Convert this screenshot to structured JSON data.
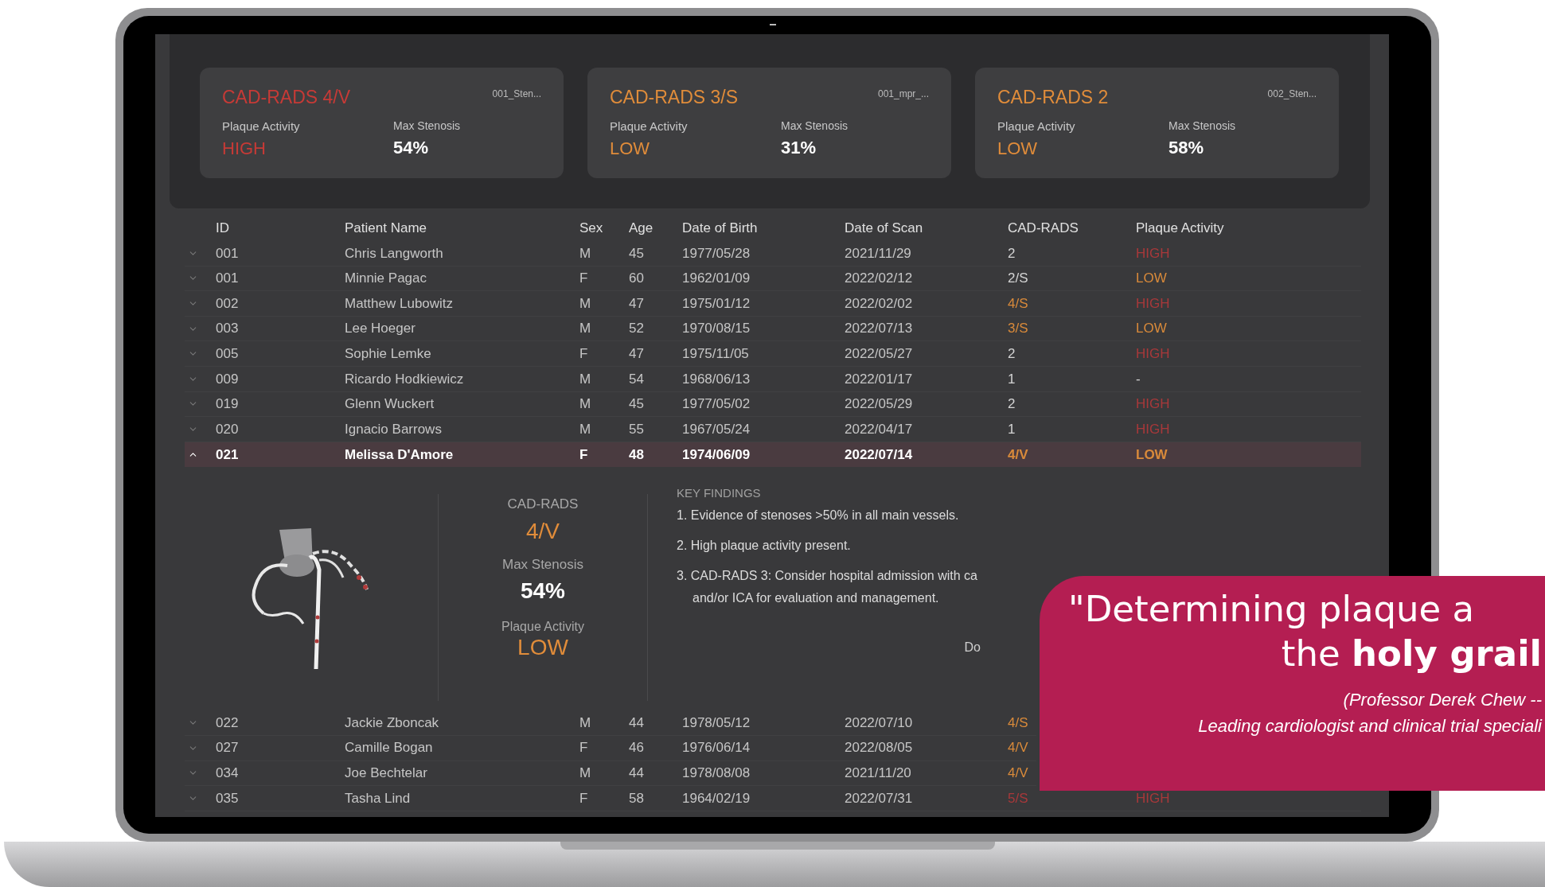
{
  "summary_cards": [
    {
      "title": "CAD-RADS 4/V",
      "color": "#c63a36",
      "file": "001_Sten...",
      "activity_label": "Plaque Activity",
      "activity": {
        "text": "HIGH",
        "color": "#c63a36"
      },
      "stenosis_label": "Max Stenosis",
      "stenosis": "54%"
    },
    {
      "title": "CAD-RADS 3/S",
      "color": "#e08c3a",
      "file": "001_mpr_...",
      "activity_label": "Plaque Activity",
      "activity": {
        "text": "LOW",
        "color": "#e08c3a"
      },
      "stenosis_label": "Max Stenosis",
      "stenosis": "31%"
    },
    {
      "title": "CAD-RADS 2",
      "color": "#e08c3a",
      "file": "002_Sten...",
      "activity_label": "Plaque Activity",
      "activity": {
        "text": "LOW",
        "color": "#e08c3a"
      },
      "stenosis_label": "Max Stenosis",
      "stenosis": "58%"
    }
  ],
  "table": {
    "columns": [
      "ID",
      "Patient Name",
      "Sex",
      "Age",
      "Date of Birth",
      "Date of Scan",
      "CAD-RADS",
      "Plaque Activity"
    ],
    "rows": [
      {
        "id": "001",
        "name": "Chris Langworth",
        "sex": "M",
        "age": "45",
        "dob": "1977/05/28",
        "dos": "2021/11/29",
        "cad_rads": {
          "text": "2",
          "color": "#d4d4d4"
        },
        "activity": {
          "text": "HIGH",
          "color": "#a8383a"
        },
        "expanded": false,
        "selected": false
      },
      {
        "id": "001",
        "name": "Minnie Pagac",
        "sex": "F",
        "age": "60",
        "dob": "1962/01/09",
        "dos": "2022/02/12",
        "cad_rads": {
          "text": "2/S",
          "color": "#d4d4d4"
        },
        "activity": {
          "text": "LOW",
          "color": "#d98a3a"
        },
        "expanded": false,
        "selected": false
      },
      {
        "id": "002",
        "name": "Matthew Lubowitz",
        "sex": "M",
        "age": "47",
        "dob": "1975/01/12",
        "dos": "2022/02/02",
        "cad_rads": {
          "text": "4/S",
          "color": "#d98a3a"
        },
        "activity": {
          "text": "HIGH",
          "color": "#a8383a"
        },
        "expanded": false,
        "selected": false
      },
      {
        "id": "003",
        "name": "Lee Hoeger",
        "sex": "M",
        "age": "52",
        "dob": "1970/08/15",
        "dos": "2022/07/13",
        "cad_rads": {
          "text": "3/S",
          "color": "#d98a3a"
        },
        "activity": {
          "text": "LOW",
          "color": "#d98a3a"
        },
        "expanded": false,
        "selected": false
      },
      {
        "id": "005",
        "name": "Sophie Lemke",
        "sex": "F",
        "age": "47",
        "dob": "1975/11/05",
        "dos": "2022/05/27",
        "cad_rads": {
          "text": "2",
          "color": "#d4d4d4"
        },
        "activity": {
          "text": "HIGH",
          "color": "#a8383a"
        },
        "expanded": false,
        "selected": false
      },
      {
        "id": "009",
        "name": "Ricardo Hodkiewicz",
        "sex": "M",
        "age": "54",
        "dob": "1968/06/13",
        "dos": "2022/01/17",
        "cad_rads": {
          "text": "1",
          "color": "#d4d4d4"
        },
        "activity": {
          "text": "-",
          "color": "#d4d4d4"
        },
        "expanded": false,
        "selected": false
      },
      {
        "id": "019",
        "name": "Glenn Wuckert",
        "sex": "M",
        "age": "45",
        "dob": "1977/05/02",
        "dos": "2022/05/29",
        "cad_rads": {
          "text": "2",
          "color": "#d4d4d4"
        },
        "activity": {
          "text": "HIGH",
          "color": "#a8383a"
        },
        "expanded": false,
        "selected": false
      },
      {
        "id": "020",
        "name": "Ignacio Barrows",
        "sex": "M",
        "age": "55",
        "dob": "1967/05/24",
        "dos": "2022/04/17",
        "cad_rads": {
          "text": "1",
          "color": "#d4d4d4"
        },
        "activity": {
          "text": "HIGH",
          "color": "#a8383a"
        },
        "expanded": false,
        "selected": false
      },
      {
        "id": "021",
        "name": "Melissa D'Amore",
        "sex": "F",
        "age": "48",
        "dob": "1974/06/09",
        "dos": "2022/07/14",
        "cad_rads": {
          "text": "4/V",
          "color": "#d98a3a"
        },
        "activity": {
          "text": "LOW",
          "color": "#d98a3a"
        },
        "expanded": true,
        "selected": true,
        "detail": {
          "cad_label": "CAD-RADS",
          "cad_value": "4/V",
          "stenosis_label": "Max Stenosis",
          "stenosis_value": "54%",
          "activity_label": "Plaque Activity",
          "activity_value": "LOW",
          "findings_title": "KEY FINDINGS",
          "findings": [
            "1. Evidence of stenoses >50% in all main vessels.",
            "2. High plaque activity present.",
            "3. CAD-RADS 3: Consider hospital admission with ca",
            "and/or ICA for evaluation and management."
          ],
          "link": "Do"
        }
      },
      {
        "id": "022",
        "name": "Jackie Zboncak",
        "sex": "M",
        "age": "44",
        "dob": "1978/05/12",
        "dos": "2022/07/10",
        "cad_rads": {
          "text": "4/S",
          "color": "#d98a3a"
        },
        "expanded": false,
        "selected": false
      },
      {
        "id": "027",
        "name": "Camille Bogan",
        "sex": "F",
        "age": "46",
        "dob": "1976/06/14",
        "dos": "2022/08/05",
        "cad_rads": {
          "text": "4/V",
          "color": "#d98a3a"
        },
        "expanded": false,
        "selected": false
      },
      {
        "id": "034",
        "name": "Joe Bechtelar",
        "sex": "M",
        "age": "44",
        "dob": "1978/08/08",
        "dos": "2021/11/20",
        "cad_rads": {
          "text": "4/V",
          "color": "#d98a3a"
        },
        "expanded": false,
        "selected": false
      },
      {
        "id": "035",
        "name": "Tasha Lind",
        "sex": "F",
        "age": "58",
        "dob": "1964/02/19",
        "dos": "2022/07/31",
        "cad_rads": {
          "text": "5/S",
          "color": "#a8383a"
        },
        "activity": {
          "text": "HIGH",
          "color": "#a8383a"
        },
        "expanded": false,
        "selected": false
      }
    ]
  },
  "quote": {
    "line_1": "\"Determining plaque a",
    "line_2": "the **holy grail**",
    "attribution_1": "(Professor Derek Chew --",
    "attribution_2": "Leading cardiologist and clinical trial speciali"
  }
}
